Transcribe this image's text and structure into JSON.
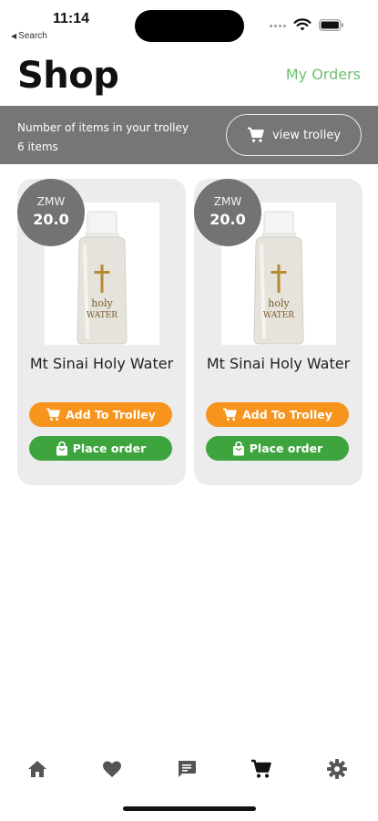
{
  "status_bar": {
    "time": "11:14",
    "back_label": "Search"
  },
  "header": {
    "title": "Shop",
    "my_orders": "My Orders"
  },
  "trolley": {
    "label": "Number of items in your trolley",
    "count": "6 items",
    "view_button": "view trolley"
  },
  "products": [
    {
      "currency": "ZMW",
      "price": "20.0",
      "name": "Mt Sinai Holy Water",
      "image_text": [
        "holy",
        "WATER"
      ],
      "add_label": "Add To Trolley",
      "order_label": "Place order"
    },
    {
      "currency": "ZMW",
      "price": "20.0",
      "name": "Mt Sinai Holy Water",
      "image_text": [
        "holy",
        "WATER"
      ],
      "add_label": "Add To Trolley",
      "order_label": "Place order"
    }
  ],
  "nav": {
    "items": [
      "home-icon",
      "heart-icon",
      "chat-icon",
      "cart-icon",
      "gear-icon"
    ],
    "active_color": "#111111",
    "inactive_color": "#555555"
  },
  "colors": {
    "banner": "#767676",
    "accent_green": "#6fc06f",
    "add_button": "#f7941d",
    "order_button": "#3ea53e",
    "card_bg": "#ececec",
    "price_badge": "#737373"
  }
}
